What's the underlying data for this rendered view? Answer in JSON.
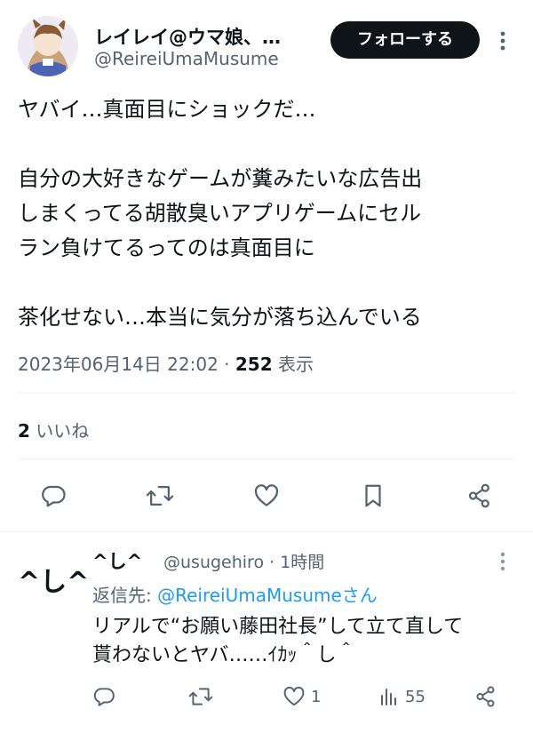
{
  "author": {
    "display_name": "レイレイ@ウマ娘、…",
    "handle": "@ReireiUmaMusume",
    "follow_label": "フォローする"
  },
  "tweet": {
    "lines_1": [
      "ヤバイ…真面目にショックだ…"
    ],
    "lines_2": [
      "自分の大好きなゲームが糞みたいな広告出",
      "しまくってる胡散臭いアプリゲームにセル",
      "ラン負けてるってのは真面目に"
    ],
    "lines_3": [
      "茶化せない…本当に気分が落ち込んでいる"
    ],
    "timestamp": "2023年06月14日 22:02 · ",
    "views_count": "252",
    "views_label": " 表示",
    "likes_count": "2",
    "likes_label": " いいね"
  },
  "reply": {
    "avatar_text": "^し^",
    "name": "^し^",
    "handle_time": "@usugehiro · 1時間",
    "reply_to_prefix": "返信先: ",
    "reply_to_link": "@ReireiUmaMusumeさん",
    "text_line1": "リアルで“お願い藤田社長”して立て直して",
    "text_line2": "貰わないとヤバ……ｲｶｯ＾し＾",
    "like_count": "1",
    "views_count": "55"
  },
  "icons": [
    "reply-icon",
    "retweet-icon",
    "like-icon",
    "bookmark-icon",
    "share-icon",
    "views-icon",
    "more-icon"
  ]
}
